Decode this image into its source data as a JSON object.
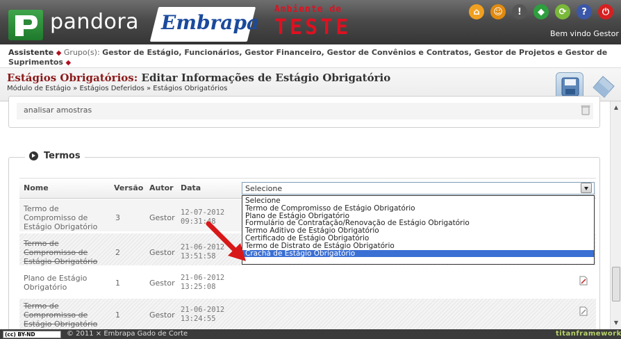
{
  "header": {
    "app_name": "pandora",
    "org_logo": "Embrapa",
    "env_line1": "Ambiente de",
    "env_line2": "TESTE",
    "welcome": "Bem vindo Gestor",
    "icons": [
      {
        "name": "home-icon",
        "glyph": "⌂",
        "color": "#f0a020"
      },
      {
        "name": "user-icon",
        "glyph": "☺",
        "color": "#e08a10"
      },
      {
        "name": "alert-icon",
        "glyph": "!",
        "color": "#555555"
      },
      {
        "name": "brazil-flag-icon",
        "glyph": "◆",
        "color": "#2e9e3e"
      },
      {
        "name": "refresh-icon",
        "glyph": "⟳",
        "color": "#7ab83a"
      },
      {
        "name": "help-icon",
        "glyph": "?",
        "color": "#3b57a8"
      },
      {
        "name": "power-icon",
        "glyph": "⏻",
        "color": "#d62020"
      }
    ]
  },
  "groups": {
    "user": "Assistente",
    "prefix": "Grupo(s):",
    "list": "Gestor de Estágio, Funcionários, Gestor Financeiro, Gestor de Convênios e Contratos, Gestor de Projetos e Gestor de Suprimentos"
  },
  "title": {
    "section": "Estágios Obrigatórios:",
    "action": "Editar Informações de Estágio Obrigatório",
    "breadcrumb": "Módulo de Estágio » Estágios Deferidos » Estágios Obrigatórios"
  },
  "previous_item": {
    "text": "analisar amostras"
  },
  "termos": {
    "legend": "Termos",
    "columns": {
      "nome": "Nome",
      "versao": "Versão",
      "autor": "Autor",
      "data": "Data"
    },
    "select": {
      "value": "Selecione",
      "options": [
        "Selecione",
        "Termo de Compromisso de Estágio Obrigatório",
        "Plano de Estágio Obrigatório",
        "Formulário de Contratação/Renovação de Estágio Obrigatório",
        "Termo Aditivo de Estágio Obrigatório",
        "Certificado de Estágio Obrigatório",
        "Termo de Distrato de Estágio Obrigatório",
        "Crachá de Estágio Obrigatório"
      ],
      "highlighted": "Crachá de Estágio Obrigatório"
    },
    "rows": [
      {
        "nome_l1": "Termo de",
        "nome_l2": "Compromisso de",
        "nome_l3": "Estágio Obrigatório",
        "versao": "3",
        "autor": "Gestor",
        "date": "12-07-2012",
        "time": "09:31:48"
      },
      {
        "nome_l1": "Termo de",
        "nome_l2": "Compromisso de",
        "nome_l3": "Estágio Obrigatório",
        "versao": "2",
        "autor": "Gestor",
        "date": "21-06-2012",
        "time": "13:51:58"
      },
      {
        "nome_l1": "Plano de Estágio",
        "nome_l2": "Obrigatório",
        "versao": "1",
        "autor": "Gestor",
        "date": "21-06-2012",
        "time": "13:25:08"
      },
      {
        "nome_l1": "Termo de",
        "nome_l2": "Compromisso de",
        "nome_l3": "Estágio Obrigatório",
        "versao": "1",
        "autor": "Gestor",
        "date": "21-06-2012",
        "time": "13:24:55"
      }
    ]
  },
  "footer": {
    "license": "(cc) BY-ND",
    "copyright": "© 2011 × Embrapa Gado de Corte",
    "framework": "titanframework"
  }
}
